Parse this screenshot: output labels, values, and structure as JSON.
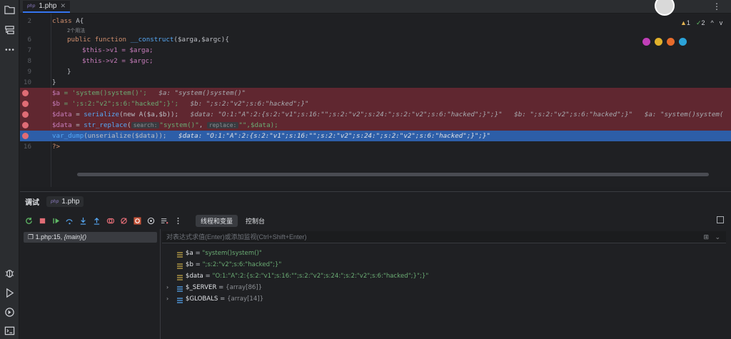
{
  "activity_bar": {
    "items": [
      "folder-icon",
      "structure-icon",
      "more-icon",
      "debug-icon",
      "run-icon",
      "services-icon",
      "terminal-icon"
    ]
  },
  "editor": {
    "tab": {
      "badge": "php",
      "label": "1.php"
    },
    "inspections": {
      "warnings": "1",
      "checks": "2"
    },
    "lines": {
      "l2": {
        "num": "2",
        "kw": "class",
        "rest": " A{"
      },
      "l_usages": {
        "text": "2个用法"
      },
      "l6": {
        "num": "6",
        "kw1": "public",
        "kw2": "function",
        "fn": "__construct",
        "rest": "($arga,$argc){"
      },
      "l7": {
        "num": "7",
        "text": "$this->v1 = $arga;"
      },
      "l8": {
        "num": "8",
        "text": "$this->v2 = $argc;"
      },
      "l9": {
        "num": "9",
        "text": "}"
      },
      "l10": {
        "num": "10",
        "text": "}"
      },
      "l11": {
        "code_var": "$a",
        "code_rest": " = 'system()system()';",
        "hint": "$a: \"system()system()\""
      },
      "l12": {
        "code_var": "$b",
        "code_rest": " = ';s:2:\"v2\";s:6:\"hacked\";}';",
        "hint": "$b: \";s:2:\"v2\";s:6:\"hacked\";}\""
      },
      "l13": {
        "code_var": "$data",
        "code_mid": " = ",
        "code_fn": "serialize",
        "code_rest": "(new A($a,$b));",
        "hint": "$data: \"O:1:\"A\":2:{s:2:\"v1\";s:16:\"\";s:2:\"v2\";s:24:\";s:2:\"v2\";s:6:\"hacked\";}\";}\"",
        "hint2": "$b: \";s:2:\"v2\";s:6:\"hacked\";}\"",
        "hint3": "$a: \"system()system("
      },
      "l14": {
        "code_var": "$data",
        "code_mid": " = ",
        "code_fn": "str_replace",
        "code_open": "(",
        "chip1": "search:",
        "arg1": "\"system()\"",
        "chip2": "replace:",
        "arg2": "\"\",$data);"
      },
      "l15": {
        "code_fn": "var_dump",
        "code_rest": "(unserialize($data));",
        "hint": "$data: \"O:1:\"A\":2:{s:2:\"v1\";s:16:\"\";s:2:\"v2\";s:24:\";s:2:\"v2\";s:6:\"hacked\";}\";}\""
      },
      "l16": {
        "num": "16",
        "text": "?>"
      }
    }
  },
  "debug": {
    "title": "调试",
    "tab_label": "1.php",
    "view_tabs": [
      "线程和变量",
      "控制台"
    ],
    "frame": {
      "location": "1.php:15,",
      "func": "{main}()"
    },
    "eval_placeholder": "对表达式求值(Enter)或添加监视(Ctrl+Shift+Enter)",
    "variables": [
      {
        "name": "$a",
        "value": "\"system()system()\""
      },
      {
        "name": "$b",
        "value": "\";s:2:\"v2\";s:6:\"hacked\";}\""
      },
      {
        "name": "$data",
        "value": "\"O:1:\"A\":2:{s:2:\"v1\";s:16:\"\";s:2:\"v2\";s:24:\";s:2:\"v2\";s:6:\"hacked\";}\";}\""
      },
      {
        "name": "$_SERVER",
        "value": "{array[86]}"
      },
      {
        "name": "$GLOBALS",
        "value": "{array[14]}"
      }
    ]
  },
  "colors": {
    "accent": "#3574f0",
    "breakpoint": "#e06c75",
    "string": "#6aab73",
    "keyword": "#cf8e6d",
    "function": "#56a8f5"
  }
}
